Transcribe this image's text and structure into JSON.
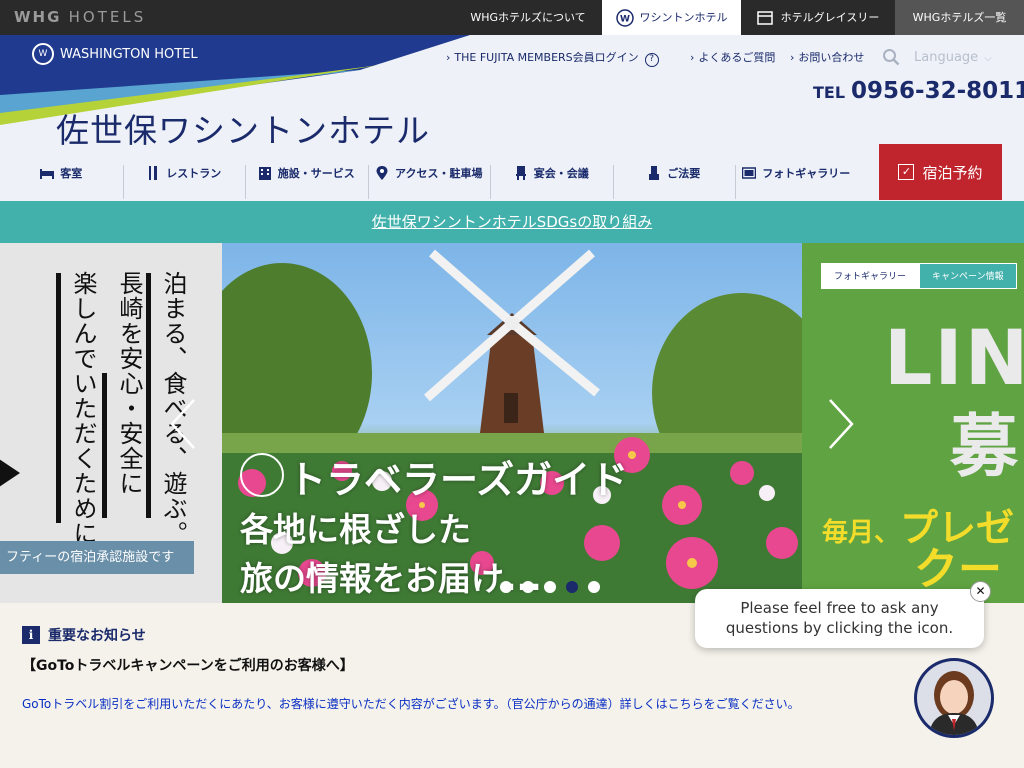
{
  "topbar": {
    "brand": "WHG",
    "brand_sub": "HOTELS",
    "tabs": [
      {
        "label": "WHGホテルズについて"
      },
      {
        "label": "ワシントンホテル"
      },
      {
        "label": "ホテルグレイスリー"
      },
      {
        "label": "WHGホテルズ一覧"
      }
    ]
  },
  "header": {
    "logo_text": "WASHINGTON HOTEL",
    "logo_seal": "W",
    "hotel_name": "佐世保ワシントンホテル",
    "util_links": [
      {
        "label": "THE FUJITA MEMBERS会員ログイン"
      },
      {
        "label": "よくあるご質問"
      },
      {
        "label": "お問い合わせ"
      }
    ],
    "help_icon": "?",
    "language": "Language",
    "tel_label": "TEL",
    "tel_number": "0956-32-8011"
  },
  "nav": {
    "items": [
      {
        "label": "客室",
        "icon": "bed-icon"
      },
      {
        "label": "レストラン",
        "icon": "fork-knife-icon"
      },
      {
        "label": "施設・サービス",
        "icon": "building-icon"
      },
      {
        "label": "アクセス・駐車場",
        "icon": "map-pin-icon"
      },
      {
        "label": "宴会・会議",
        "icon": "chair-icon"
      },
      {
        "label": "ご法要",
        "icon": "altar-icon"
      },
      {
        "label": "フォトギャラリー",
        "icon": "monitor-icon"
      }
    ],
    "reserve_label": "宿泊予約",
    "reserve_icon": "✓"
  },
  "sdgs_link": "佐世保ワシントンホテルSDGsの取り組み",
  "slider": {
    "left": {
      "lines": [
        "泊まる、食べる、遊ぶ。",
        "長崎を安心・安全に",
        "楽しんでいただくために。"
      ],
      "caption": "フティーの宿泊承認施設です"
    },
    "main": {
      "title": "トラベラーズガイド",
      "subtitle_lines": [
        "各地に根ざした",
        "旅の情報をお届け..."
      ]
    },
    "right": {
      "tab1": "フォトギャラリー",
      "tab2": "キャンペーン情報",
      "big1": "LIN",
      "big2": "募",
      "line3_prefix": "毎月、",
      "line3": "プレゼ",
      "line4": "クー"
    },
    "dots": 6,
    "active_dot": 3
  },
  "notice": {
    "heading": "重要なお知らせ",
    "title": "【GoToトラベルキャンペーンをご利用のお客様へ】",
    "body": "GoToトラベル割引をご利用いただくにあたり、お客様に遵守いただく内容がございます。（官公庁からの通達）詳しくはこちらをご覧ください。"
  },
  "chat": {
    "line1": "Please feel free to ask any",
    "line2": "questions by clicking the icon.",
    "close": "✕"
  },
  "colors": {
    "navy": "#1a2a6b",
    "teal": "#42b0ab",
    "red": "#c0252e",
    "dark_bar": "#2a2a2a"
  }
}
